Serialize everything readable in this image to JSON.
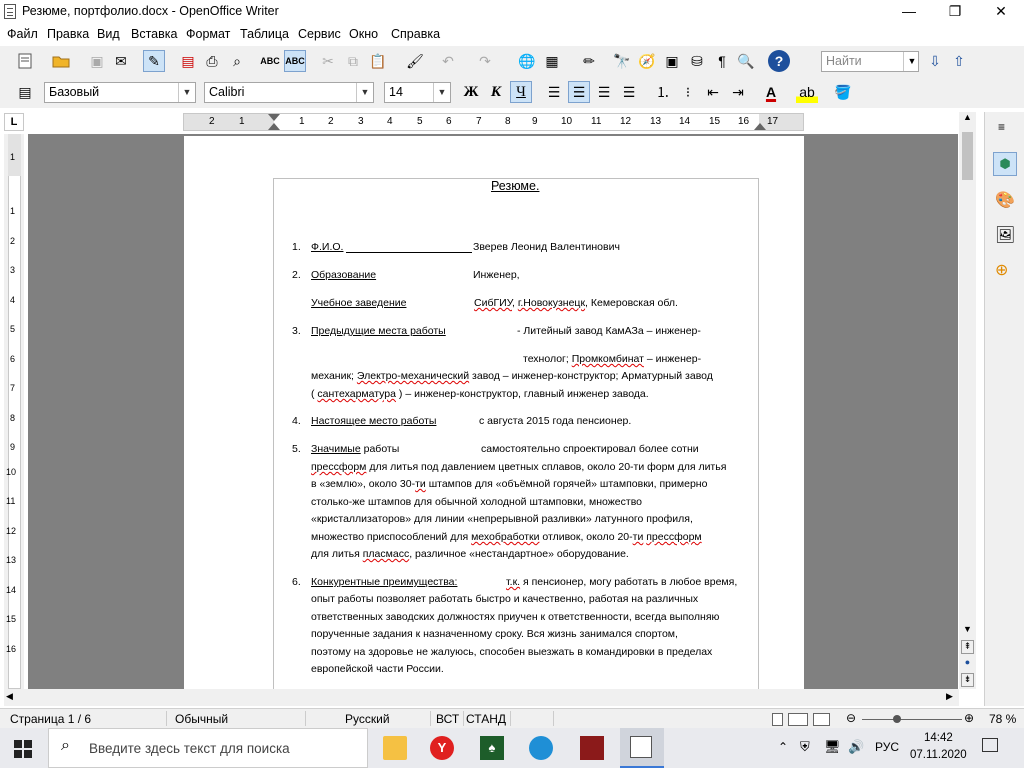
{
  "window": {
    "title": "Резюме, портфолио.docx - OpenOffice Writer",
    "minimize": "—",
    "maximize": "❐",
    "close": "✕"
  },
  "menu": [
    "Файл",
    "Правка",
    "Вид",
    "Вставка",
    "Формат",
    "Таблица",
    "Сервис",
    "Окно",
    "Справка"
  ],
  "toolbar": {
    "find_placeholder": "Найти",
    "style_value": "Базовый",
    "font_value": "Calibri",
    "size_value": "14",
    "bold": "Ж",
    "italic": "К",
    "underline": "Ч"
  },
  "ruler": {
    "marks": [
      "2",
      "1",
      "1",
      "2",
      "3",
      "4",
      "5",
      "6",
      "7",
      "8",
      "9",
      "10",
      "11",
      "12",
      "13",
      "14",
      "15",
      "16",
      "17"
    ],
    "vmarks": [
      "1",
      "1",
      "2",
      "3",
      "4",
      "5",
      "6",
      "7",
      "8",
      "9",
      "10",
      "11",
      "12",
      "13",
      "14",
      "15",
      "16"
    ]
  },
  "document": {
    "heading": "Резюме.",
    "items": [
      {
        "num": "1.",
        "label": "Ф.И.О.",
        "value": "Зверев Леонид Валентинович"
      },
      {
        "num": "2.",
        "label": "Образование",
        "value": "Инженер,"
      },
      {
        "num": "",
        "label": "Учебное заведение",
        "value_parts": [
          "СибГИУ",
          ", ",
          "г.Новокузнецк",
          ", Кемеровская обл."
        ]
      },
      {
        "num": "3.",
        "label": "Предыдущие места работы",
        "lines": [
          "- Литейный завод КамАЗа – инженер-",
          "технолог; ",
          "Промкомбинат",
          " – инженер-",
          "механик; ",
          "Электро-механический",
          " завод – инженер-конструктор; Арматурный завод",
          "( ",
          "сантехарматура",
          " ) – инженер-конструктор, главный инженер завода."
        ]
      },
      {
        "num": "4.",
        "label": "Настоящее место работы",
        "value": "с августа 2015 года пенсионер."
      },
      {
        "num": "5.",
        "label": "Значимые",
        "label_rest": " работы",
        "lines": [
          "самостоятельно спроектировал более сотни",
          "прессформ",
          " для литья под давлением цветных сплавов, около 20-ти форм для литья",
          "в «землю», около 30-",
          "ти",
          " штампов для «объёмной горячей» штамповки, примерно",
          "столько-же штампов для обычной холодной штамповки, множество",
          "«кристаллизаторов» для линии  «непрерывной разливки» латунного профиля,",
          "множество приспособлений для ",
          "мехобработки",
          " отливок, около 20-",
          "ти",
          " ",
          "прессформ",
          "для литья ",
          "пласмасс",
          ", различное «нестандартное» оборудование."
        ]
      },
      {
        "num": "6.",
        "label": "Конкурентные преимущества:",
        "lines": [
          "т.к.",
          " я пенсионер, могу работать в любое время,",
          "опыт работы позволяет работать быстро и качественно, работая на различных",
          "ответственных заводских должностях приучен к ответственности, всегда выполняю",
          "порученные задания к назначенному сроку. Вся жизнь занимался спортом,",
          "поэтому на здоровье не жалуюсь, способен выезжать в командировки в пределах",
          "европейской части России."
        ]
      }
    ]
  },
  "status": {
    "page": "Страница  1 / 6",
    "style": "Обычный",
    "language": "Русский",
    "insert": "ВСТ",
    "select": "СТАНД",
    "zoom": "78 %"
  },
  "taskbar": {
    "search_placeholder": "Введите здесь текст для поиска",
    "language": "РУС",
    "time": "14:42",
    "date": "07.11.2020"
  }
}
